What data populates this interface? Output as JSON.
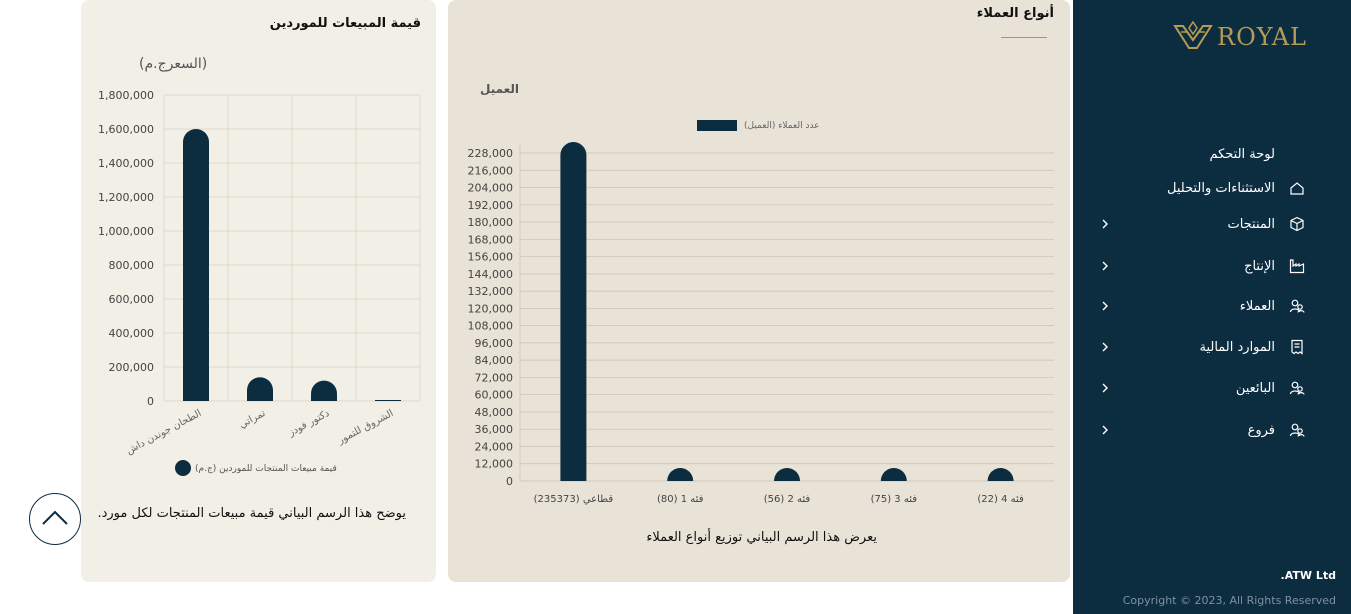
{
  "sidebar": {
    "logo_text": "ROYAL",
    "items": [
      {
        "label": "لوحة التحكم",
        "icon": "",
        "has_chevron": false
      },
      {
        "label": "الاستثناءات والتحليل",
        "icon": "home-icon",
        "has_chevron": false
      },
      {
        "label": "المنتجات",
        "icon": "box-icon",
        "has_chevron": true
      },
      {
        "label": "الإنتاج",
        "icon": "factory-icon",
        "has_chevron": true
      },
      {
        "label": "العملاء",
        "icon": "users-icon",
        "has_chevron": true
      },
      {
        "label": "الموارد المالية",
        "icon": "receipt-icon",
        "has_chevron": true
      },
      {
        "label": "البائعين",
        "icon": "users-icon",
        "has_chevron": true
      },
      {
        "label": "فروع",
        "icon": "users-icon",
        "has_chevron": true
      }
    ],
    "company": ".ATW Ltd",
    "copyright": "Copyright © 2023, All Rights Reserved"
  },
  "customer_card": {
    "title": "أنواع العملاء",
    "caption": "يعرض هذا الرسم البياني توزيع أنواع العملاء"
  },
  "supplier_card": {
    "title": "قيمة المبيعات للموردين",
    "caption": "يوضح هذا الرسم البياني قيمة مبيعات المنتجات لكل مورد."
  },
  "colors": {
    "bar": "#0c2c40",
    "accent": "#b59b55"
  },
  "chart_data": [
    {
      "type": "bar",
      "title": "",
      "ylabel": "العميل",
      "xlabel": "",
      "categories": [
        "قطاعي (235373)",
        "فئه 1 (80)",
        "فئه 2 (56)",
        "فئه 3 (75)",
        "فئه 4 (22)"
      ],
      "series": [
        {
          "name": "عدد العملاء (العميل)",
          "values": [
            235373,
            80,
            56,
            75,
            22
          ]
        }
      ],
      "ylim": [
        0,
        228000
      ],
      "yticks": [
        "0",
        "12,000",
        "24,000",
        "36,000",
        "48,000",
        "60,000",
        "72,000",
        "84,000",
        "96,000",
        "108,000",
        "120,000",
        "132,000",
        "144,000",
        "156,000",
        "168,000",
        "180,000",
        "192,000",
        "204,000",
        "216,000",
        "228,000"
      ],
      "grid": true,
      "legend": "top"
    },
    {
      "type": "bar",
      "title": "",
      "ylabel": "(السعرج.م)",
      "xlabel": "",
      "categories": [
        "الطحان جوندن داش",
        "تمراتي",
        "دكتور فودز",
        "الشروق للتمور"
      ],
      "series": [
        {
          "name": "قيمة مبيعات المنتجات للموردين (ج.م)",
          "values": [
            1600000,
            140000,
            120000,
            5000
          ]
        }
      ],
      "ylim": [
        0,
        1800000
      ],
      "yticks": [
        "0",
        "200,000",
        "400,000",
        "600,000",
        "800,000",
        "1,000,000",
        "1,200,000",
        "1,400,000",
        "1,600,000",
        "1,800,000"
      ],
      "grid": true,
      "legend": "bottom"
    }
  ]
}
